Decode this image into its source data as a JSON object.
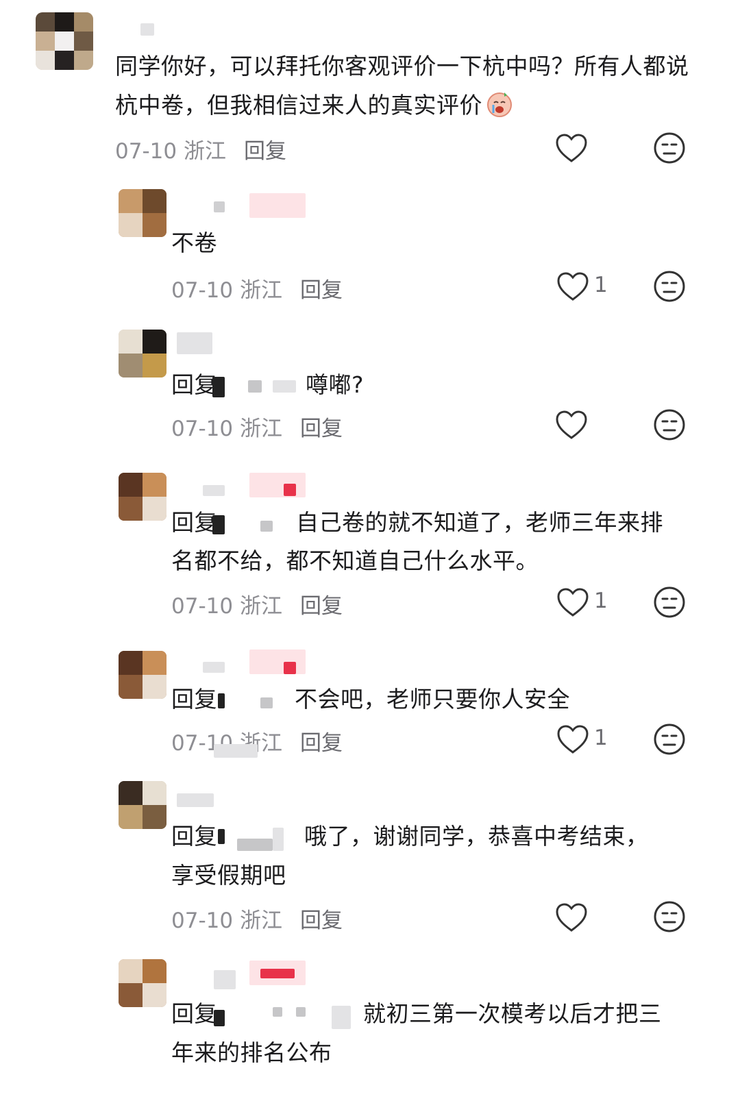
{
  "comments": [
    {
      "text": "同学你好，可以拜托你客观评价一下杭中吗？所有人都说杭中卷，但我相信过来人的真实评价",
      "date": "07-10",
      "region": "浙江",
      "reply_label": "回复",
      "likes": ""
    },
    {
      "text": "不卷",
      "date": "07-10",
      "region": "浙江",
      "reply_label": "回复",
      "likes": "1"
    },
    {
      "prefix": "回复",
      "text": "噂嘟?",
      "date": "07-10",
      "region": "浙江",
      "reply_label": "回复",
      "likes": ""
    },
    {
      "prefix": "回复",
      "text_line1": "自己卷的就不知道了，老师三年来排",
      "text_line2": "名都不给，都不知道自己什么水平。",
      "date": "07-10",
      "region": "浙江",
      "reply_label": "回复",
      "likes": "1"
    },
    {
      "prefix": "回复",
      "text": "不会吧，老师只要你人安全",
      "date": "07-10",
      "region": "浙江",
      "reply_label": "回复",
      "likes": "1"
    },
    {
      "prefix": "回复",
      "text_line1": "哦了，谢谢同学，恭喜中考结束，",
      "text_line2": "享受假期吧",
      "date": "07-10",
      "region": "浙江",
      "reply_label": "回复",
      "likes": ""
    },
    {
      "prefix": "回复",
      "text_line1": "就初三第一次模考以后才把三",
      "text_line2": "年来的排名公布"
    }
  ],
  "icons": {
    "like": "heart-outline-icon",
    "dislike": "neutral-face-icon",
    "emoji": "crying-face-emoji"
  },
  "colors": {
    "text": "#1c1c1e",
    "meta": "#8e8e93",
    "icon": "#333333"
  }
}
